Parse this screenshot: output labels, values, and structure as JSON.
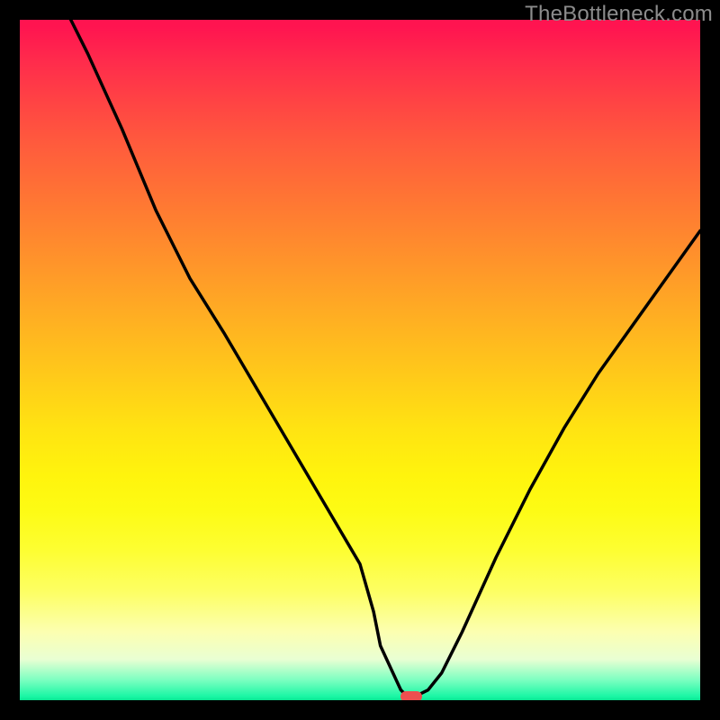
{
  "attribution": "TheBottleneck.com",
  "colors": {
    "frame": "#000000",
    "attribution_text": "#8C8C8C",
    "curve_stroke": "#000000",
    "pill": "#ed4f4f",
    "gradient_stops": [
      "#ff1450",
      "#ff2b4c",
      "#ff4344",
      "#ff5a3d",
      "#ff7135",
      "#ff882e",
      "#ff9f27",
      "#ffb620",
      "#ffcc19",
      "#ffe312",
      "#fff40d",
      "#fdfb14",
      "#fdfe32",
      "#fdff63",
      "#fcffb1",
      "#e9ffd3",
      "#7dffc1",
      "#18f6a4",
      "#09e692"
    ]
  },
  "chart_data": {
    "type": "line",
    "title": "",
    "xlabel": "",
    "ylabel": "",
    "xlim": [
      0,
      100
    ],
    "ylim": [
      0,
      100
    ],
    "grid": false,
    "x": [
      7.5,
      10,
      15,
      20,
      22.5,
      25,
      30,
      35,
      40,
      45,
      50,
      52,
      53,
      56,
      57,
      58,
      60,
      62,
      65,
      70,
      75,
      80,
      85,
      90,
      95,
      100
    ],
    "values": [
      100,
      95,
      84,
      72,
      67,
      62,
      54,
      45.5,
      37,
      28.5,
      20,
      13,
      8,
      1.5,
      0.5,
      0.5,
      1.5,
      4,
      10,
      21,
      31,
      40,
      48,
      55,
      62,
      69
    ],
    "flat_segment": {
      "x_start": 53,
      "x_end": 57,
      "y": 0.5
    },
    "marker": {
      "type": "pill",
      "x_center": 57.5,
      "y": 0.5,
      "width_frac": 0.032,
      "height_frac": 0.016
    }
  }
}
